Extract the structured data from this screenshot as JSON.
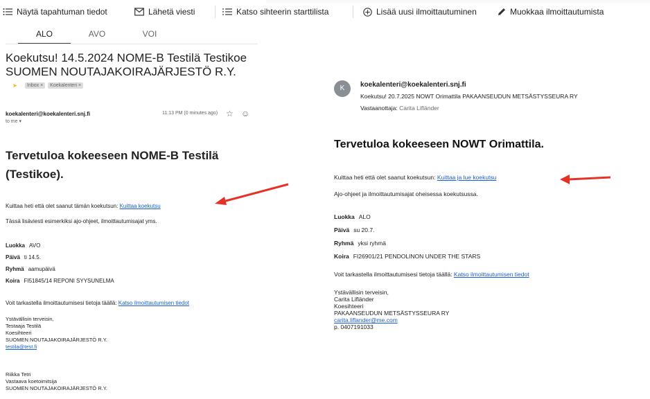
{
  "toolbar": {
    "items": [
      {
        "label": "Näytä tapahtuman tiedot",
        "icon": "list-icon"
      },
      {
        "label": "Lähetä viesti",
        "icon": "mail-icon"
      },
      {
        "label": "Katso sihteerin starttilista",
        "icon": "list-icon"
      },
      {
        "label": "Lisää uusi ilmoittautuminen",
        "icon": "plus-circle-icon"
      },
      {
        "label": "Muokkaa ilmoittautumista",
        "icon": "pencil-icon"
      }
    ]
  },
  "tabs": [
    {
      "label": "ALO",
      "active": true
    },
    {
      "label": "AVO",
      "active": false
    },
    {
      "label": "VOI",
      "active": false
    }
  ],
  "left_email": {
    "subject": "Koekutsu! 14.5.2024 NOME-B Testilä Testikoe SUOMEN NOUTAJAKOIRAJÄRJESTÖ R.Y.",
    "labels": [
      "Inbox ×",
      "Koekalenteri ×"
    ],
    "sender": "koekalenteri@koekalenteri.snj.fi",
    "time": "11:13 PM (0 minutes ago)",
    "to": "to me ▾",
    "greeting": "Tervetuloa kokeeseen NOME-B Testilä (Testikoe).",
    "ack_text": "Kuittaa heti että olet saanut tämän koekutsun: ",
    "ack_link": "Kuittaa koekutsu",
    "extra": "Tässä lisäviesti esimerkiksi ajo-ohjeet, ilmoittautumisajat yms.",
    "info": [
      {
        "key": "Luokka",
        "value": "AVO"
      },
      {
        "key": "Päivä",
        "value": "ti 14.5."
      },
      {
        "key": "Ryhmä",
        "value": "aamupäivä"
      },
      {
        "key": "Koira",
        "value": "FI51845/14 REPONI SYYSUNELMA"
      }
    ],
    "view_text": "Voit tarkastella ilmoittautumisesi tietoja täällä: ",
    "view_link": "Katso ilmoittautumisen tiedot",
    "sig": [
      "Ystävällisin terveisin,",
      "Testaaja Testilä",
      "Koesihteeri",
      "SUOMEN NOUTAJAKOIRAJÄRJESTÖ R.Y."
    ],
    "sig_email": "testila@test.fi",
    "sig2": [
      "Riikka Tetri",
      "Vastaava koetoimitsija",
      "SUOMEN NOUTAJAKOIRAJÄRJESTÖ R.Y."
    ]
  },
  "right_email": {
    "avatar": "K",
    "from": "koekalenteri@koekalenteri.snj.fi",
    "subject": "Koekutsu! 20.7.2025 NOWT Orimattila PAKAANSEUDUN METSÄSTYSSEURA RY",
    "to_label": "Vastaanottaja:",
    "to_value": "Carita Lifländer",
    "greeting": "Tervetuloa kokeeseen NOWT Orimattila.",
    "ack_text": "Kuittaa heti että olet saanut koekutsun: ",
    "ack_link": "Kuittaa ja lue koekutsu",
    "extra": "Ajo-ohjeet ja ilmoittautumisajat oheisessa koekutsussa.",
    "info": [
      {
        "key": "Luokka",
        "value": "ALO"
      },
      {
        "key": "Päivä",
        "value": "su 20.7."
      },
      {
        "key": "Ryhmä",
        "value": "yksi ryhmä"
      },
      {
        "key": "Koira",
        "value": "FI26901/21 PENDOLINON UNDER THE STARS"
      }
    ],
    "view_text": "Voit tarkastella ilmoittautumisesi tietoja täällä: ",
    "view_link": "Katso ilmoittautumisen tiedot",
    "sig": [
      "Ystävällisin terveisin,",
      "Carita Lifländer",
      "Koesihteeri",
      "PAKAANSEUDUN METSÄSTYSSEURA RY"
    ],
    "sig_email": "carita.liflander@me.com",
    "sig_phone": "p. 0407191033"
  },
  "colors": {
    "link": "#1a5fd1",
    "arrow": "#e53224"
  }
}
